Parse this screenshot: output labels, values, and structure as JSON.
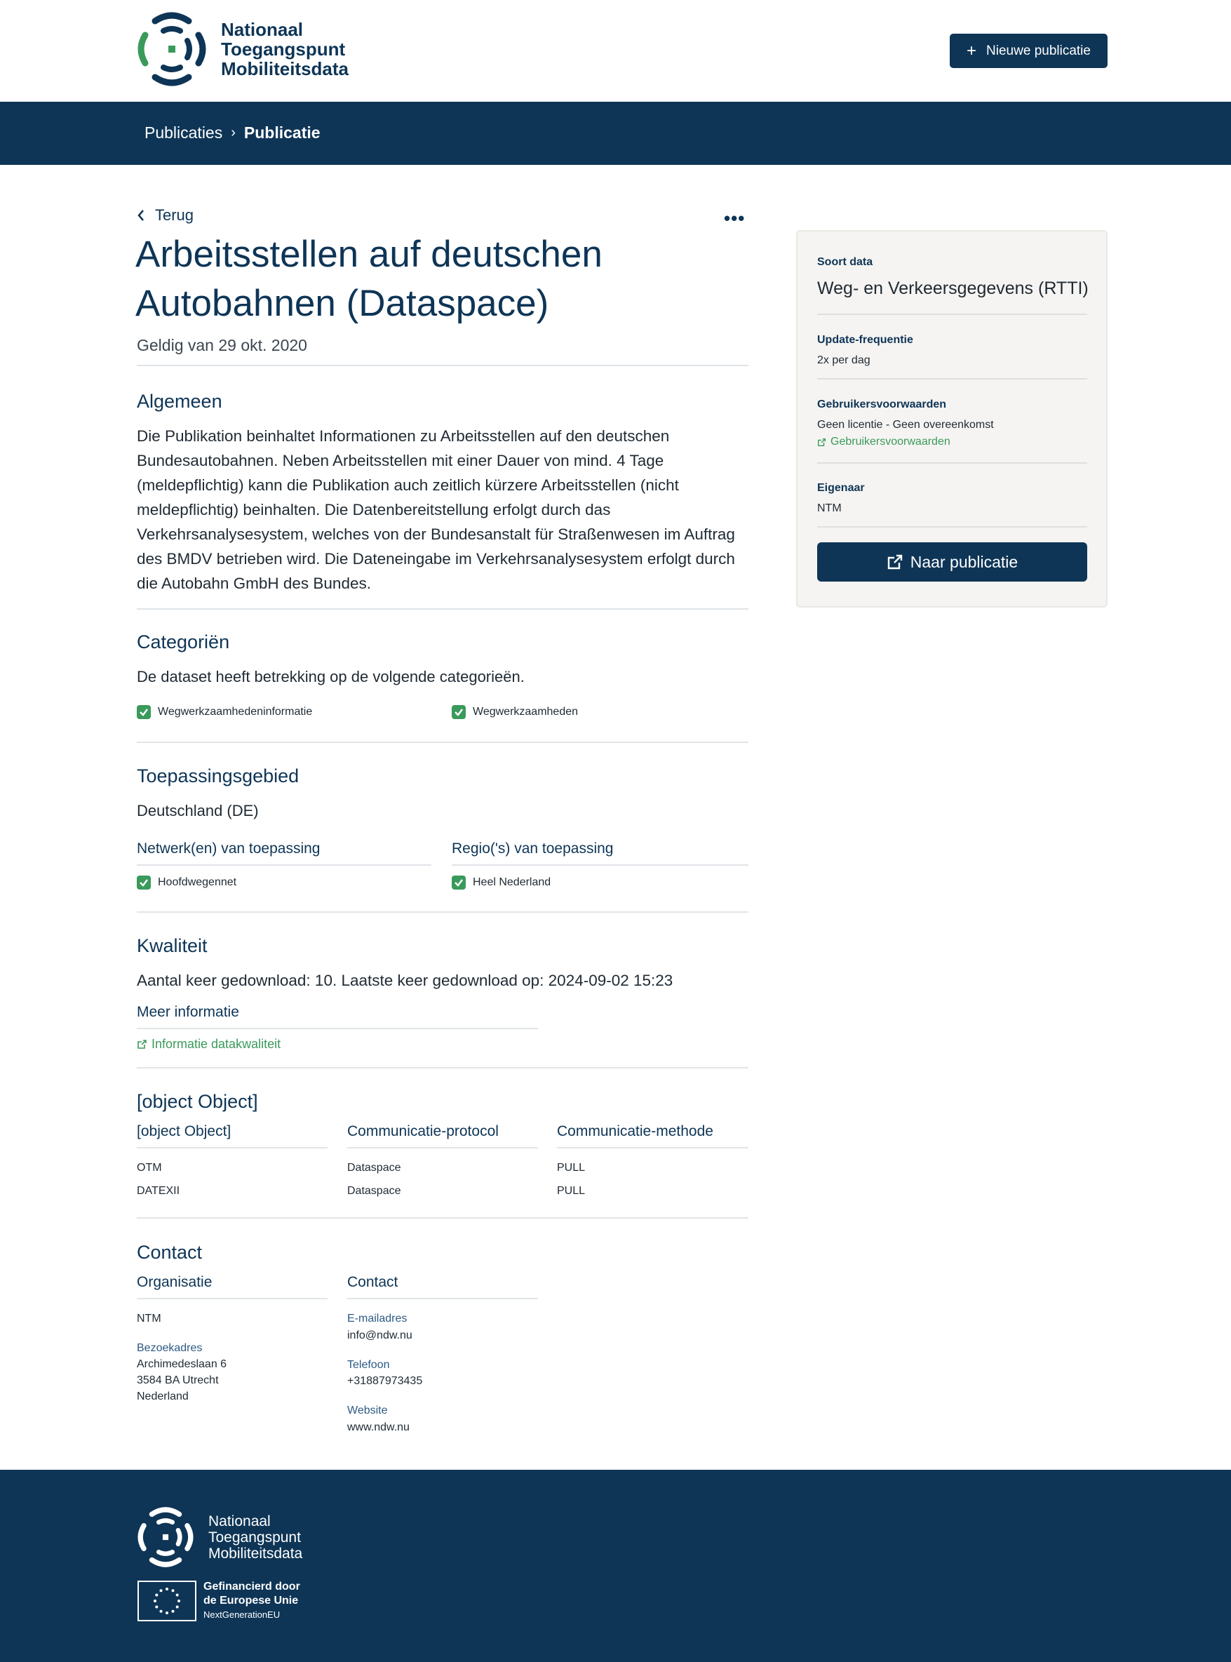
{
  "header": {
    "logo_line1": "Nationaal",
    "logo_line2": "Toegangspunt",
    "logo_line3": "Mobiliteitsdata",
    "new_button": "Nieuwe publicatie"
  },
  "breadcrumb": {
    "item1": "Publicaties",
    "separator": "›",
    "item2": "Publicatie"
  },
  "page": {
    "back": "Terug",
    "more": "•••",
    "title_line1": "Arbeitsstellen auf deutschen",
    "title_line2": "Autobahnen (Dataspace)",
    "valid": "Geldig van 29 okt. 2020"
  },
  "general": {
    "heading": "Algemeen",
    "lines": [
      "Die Publikation beinhaltet Informationen zu Arbeitsstellen auf den deutschen",
      "Bundesautobahnen. Neben Arbeitsstellen mit einer Dauer von mind. 4 Tage",
      "(meldepflichtig) kann die Publikation auch zeitlich kürzere Arbeitsstellen (nicht",
      "meldepflichtig) beinhalten. Die Datenbereitstellung erfolgt durch das",
      "Verkehrsanalysesystem, welches von der Bundesanstalt für Straßenwesen im Auftrag",
      "des BMDV betrieben wird. Die Dateneingabe im Verkehrsanalysesystem erfolgt durch",
      "die Autobahn GmbH des Bundes."
    ]
  },
  "categories": {
    "heading": "Categoriën",
    "intro": "De dataset heeft betrekking op de volgende categorieën.",
    "items": [
      "Wegwerkzaamhedeninformatie",
      "Wegwerkzaamheden"
    ]
  },
  "scope": {
    "heading": "Toepassingsgebied",
    "country": "Deutschland (DE)",
    "networks_label": "Netwerk(en) van toepassing",
    "regions_label": "Regio('s) van toepassing",
    "network": "Hoofdwegennet",
    "region": "Heel Nederland"
  },
  "quality": {
    "heading": "Kwaliteit",
    "downloads": "Aantal keer gedownload: 10. Laatste keer gedownload op: 2024-09-02 15:23",
    "more_label": "Meer informatie",
    "link": "Informatie datakwaliteit"
  },
  "protocol": {
    "heading": "[object Object]",
    "col1": "[object Object]",
    "col2": "Communicatie-protocol",
    "col3": "Communicatie-methode",
    "rows": [
      {
        "a": "OTM",
        "b": "Dataspace",
        "c": "PULL"
      },
      {
        "a": "DATEXII",
        "b": "Dataspace",
        "c": "PULL"
      }
    ]
  },
  "contact": {
    "heading": "Contact",
    "org_label": "Organisatie",
    "contact_label": "Contact",
    "org_name": "NTM",
    "visit_label": "Bezoekadres",
    "address1": "Archimedeslaan 6",
    "address2": "3584 BA Utrecht",
    "address3": "Nederland",
    "email_label": "E-mailadres",
    "email": "info@ndw.nu",
    "phone_label": "Telefoon",
    "phone": "+31887973435",
    "website_label": "Website",
    "website": "www.ndw.nu"
  },
  "sidebar": {
    "type_label": "Soort data",
    "type_value": "Weg- en Verkeersgegevens (RTTI)",
    "freq_label": "Update-frequentie",
    "freq_value": "2x per dag",
    "terms_label": "Gebruikersvoorwaarden",
    "terms_value": "Geen licentie - Geen overeenkomst",
    "terms_link": "Gebruikersvoorwaarden",
    "owner_label": "Eigenaar",
    "owner_value": "NTM",
    "button": "Naar publicatie"
  },
  "footer": {
    "logo_line1": "Nationaal",
    "logo_line2": "Toegangspunt",
    "logo_line3": "Mobiliteitsdata",
    "eu_line1": "Gefinancierd door",
    "eu_line2": "de Europese Unie",
    "eu_line3": "NextGenerationEU"
  },
  "colors": {
    "brand": "#0e3556",
    "accent": "#3a9a5b"
  }
}
